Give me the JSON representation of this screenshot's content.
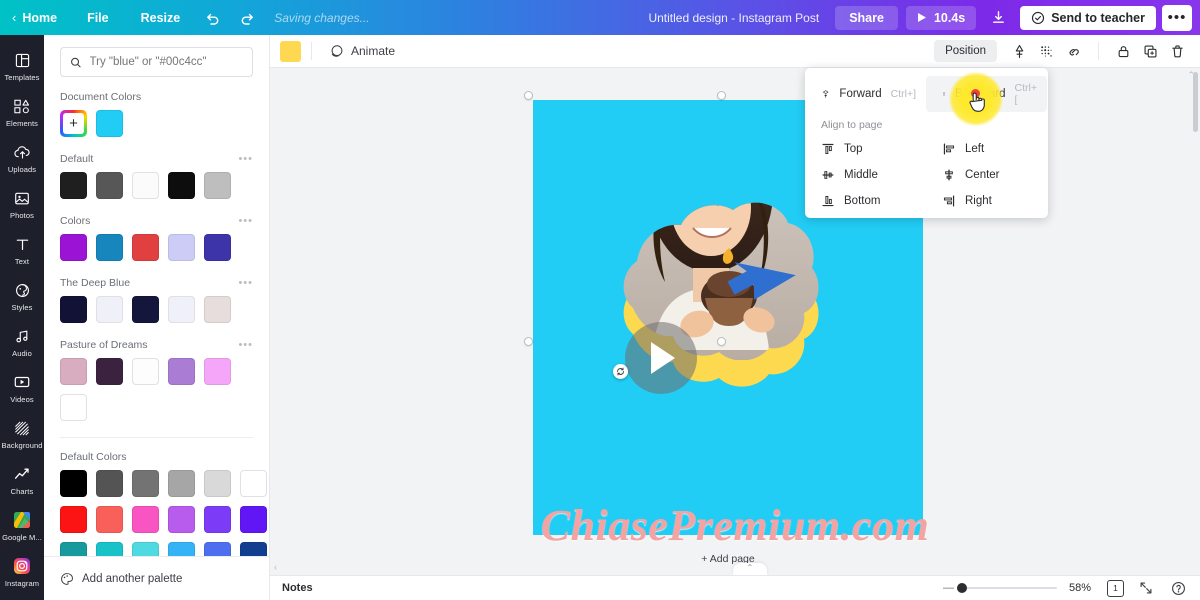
{
  "header": {
    "home_label": "Home",
    "file_label": "File",
    "resize_label": "Resize",
    "undo_icon": "undo-icon",
    "redo_icon": "redo-icon",
    "saving_status": "Saving changes...",
    "design_title": "Untitled design - Instagram Post",
    "share_label": "Share",
    "play_duration": "10.4s",
    "download_icon": "download-icon",
    "send_label": "Send to teacher",
    "more_label": "•••"
  },
  "rail": {
    "items": [
      {
        "label": "Templates",
        "icon": "templates-icon"
      },
      {
        "label": "Elements",
        "icon": "elements-icon"
      },
      {
        "label": "Uploads",
        "icon": "uploads-icon"
      },
      {
        "label": "Photos",
        "icon": "photos-icon"
      },
      {
        "label": "Text",
        "icon": "text-icon"
      },
      {
        "label": "Styles",
        "icon": "styles-icon"
      },
      {
        "label": "Audio",
        "icon": "audio-icon"
      },
      {
        "label": "Videos",
        "icon": "videos-icon"
      },
      {
        "label": "Background",
        "icon": "background-icon"
      },
      {
        "label": "Charts",
        "icon": "charts-icon"
      },
      {
        "label": "Google M...",
        "icon": "google-maps-icon"
      },
      {
        "label": "Instagram",
        "icon": "instagram-icon"
      }
    ]
  },
  "panel": {
    "search_placeholder": "Try \"blue\" or \"#00c4cc\"",
    "search_value": "",
    "search_icon": "search-icon",
    "sections": [
      {
        "title": "Document Colors",
        "has_menu": false,
        "add_swatch": true,
        "colors": [
          "#22cdf5"
        ]
      },
      {
        "title": "Default",
        "has_menu": true,
        "colors": [
          "#1f1f1f",
          "#575757",
          "#fbfbfb",
          "#0d0d0d",
          "#bebebe"
        ]
      },
      {
        "title": "Colors",
        "has_menu": true,
        "colors": [
          "#9b14d6",
          "#1686bd",
          "#e14040",
          "#ccccf7",
          "#3c34a8"
        ]
      },
      {
        "title": "The Deep Blue",
        "has_menu": true,
        "colors": [
          "#111236",
          "#eff0f8",
          "#14163c",
          "#eff0fa",
          "#e7dddc"
        ]
      },
      {
        "title": "Pasture of Dreams",
        "has_menu": true,
        "colors": [
          "#d8adc0",
          "#3b2340",
          "#fdfdfd",
          "#ab7cd4",
          "#f6a6f8",
          "#ffffff"
        ]
      }
    ],
    "default_colors_title": "Default Colors",
    "default_colors": [
      "#000000",
      "#545454",
      "#737373",
      "#a6a6a6",
      "#d9d9d9",
      "#ffffff",
      "#fc1313",
      "#f9605a",
      "#f855c2",
      "#b75ced",
      "#7c3bf7",
      "#6116f5",
      "#169a9e",
      "#19c2c8",
      "#4fd9e0",
      "#34b3f6",
      "#4e6ef0",
      "#123e8f",
      "#139048",
      "#6fce57",
      "#cede67",
      "#fed850",
      "#f9bc4f",
      "#f79448"
    ],
    "selected_default_color": "#fed850",
    "add_palette_label": "Add another palette",
    "palette_icon": "palette-icon"
  },
  "objbar": {
    "selected_color": "#fed850",
    "animate_label": "Animate",
    "animate_icon": "animate-icon",
    "position_label": "Position",
    "icons": [
      "transparency-icon",
      "effects-icon",
      "link-icon",
      "lock-icon",
      "duplicate-icon",
      "trash-icon"
    ]
  },
  "posmenu": {
    "forward_label": "Forward",
    "forward_key": "Ctrl+]",
    "forward_icon": "bring-forward-icon",
    "backward_label": "Backward",
    "backward_key": "Ctrl+[",
    "backward_icon": "send-backward-icon",
    "align_label": "Align to page",
    "align_items": [
      {
        "label": "Top",
        "icon": "align-top-icon"
      },
      {
        "label": "Left",
        "icon": "align-left-icon"
      },
      {
        "label": "Middle",
        "icon": "align-middle-icon"
      },
      {
        "label": "Center",
        "icon": "align-center-icon"
      },
      {
        "label": "Bottom",
        "icon": "align-bottom-icon"
      },
      {
        "label": "Right",
        "icon": "align-right-icon"
      }
    ]
  },
  "canvas": {
    "background_color": "#22cdf5",
    "blob_color": "#fcd94f",
    "add_page_label": "+ Add page",
    "play_icon": "play-icon",
    "rotate_icon": "rotate-icon",
    "arrow_color": "#2f6fd0",
    "watermark": "ChiasePremium.com"
  },
  "bottombar": {
    "notes_label": "Notes",
    "zoom_percent": "58%",
    "page_number": "1",
    "expand_icon": "expand-icon",
    "help_icon": "help-icon"
  }
}
